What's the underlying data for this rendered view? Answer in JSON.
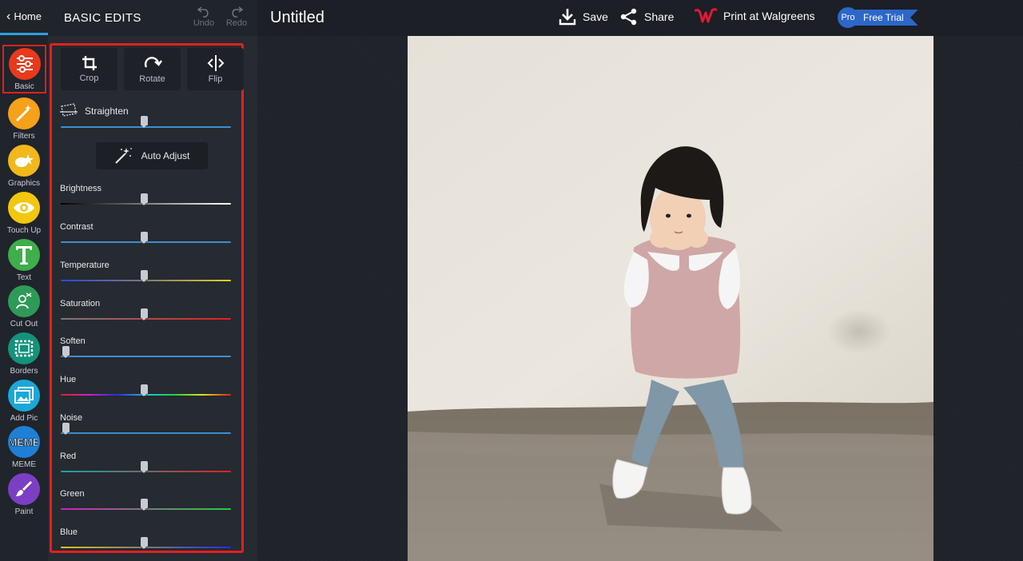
{
  "rail": {
    "home_label": "Home",
    "tools": [
      {
        "label": "Basic",
        "color": "#e8391c",
        "icon": "sliders-icon",
        "active": true
      },
      {
        "label": "Filters",
        "color": "#f5a11a",
        "icon": "magic-wand-icon"
      },
      {
        "label": "Graphics",
        "color": "#f0b81a",
        "icon": "stars-icon"
      },
      {
        "label": "Touch Up",
        "color": "#f2c70e",
        "icon": "eye-icon"
      },
      {
        "label": "Text",
        "color": "#3fae4b",
        "icon": "text-t-icon"
      },
      {
        "label": "Cut Out",
        "color": "#2e9a58",
        "icon": "cutout-person-icon"
      },
      {
        "label": "Borders",
        "color": "#14927a",
        "icon": "border-frame-icon"
      },
      {
        "label": "Add Pic",
        "color": "#1aa8d8",
        "icon": "add-picture-icon"
      },
      {
        "label": "MEME",
        "color": "#1e7fd6",
        "icon": "meme-icon"
      },
      {
        "label": "Paint",
        "color": "#7b3fc4",
        "icon": "paint-brush-icon"
      }
    ]
  },
  "panel": {
    "title": "BASIC EDITS",
    "undo_label": "Undo",
    "redo_label": "Redo",
    "quick_actions": [
      {
        "label": "Crop",
        "icon": "crop-icon"
      },
      {
        "label": "Rotate",
        "icon": "rotate-icon"
      },
      {
        "label": "Flip",
        "icon": "flip-icon"
      }
    ],
    "straighten": {
      "label": "Straighten",
      "value": 0.5
    },
    "auto_adjust_label": "Auto Adjust",
    "sliders": [
      {
        "label": "Brightness",
        "value": 0.5,
        "gradient": "linear-gradient(90deg,#000,#fff)"
      },
      {
        "label": "Contrast",
        "value": 0.5,
        "gradient": "linear-gradient(90deg,#3b8fd0,#3b8fd0)"
      },
      {
        "label": "Temperature",
        "value": 0.5,
        "gradient": "linear-gradient(90deg,#2a48d8,#7b7b7b,#e6d01c)"
      },
      {
        "label": "Saturation",
        "value": 0.5,
        "gradient": "linear-gradient(90deg,#7a7a7a,#e02020)"
      },
      {
        "label": "Soften",
        "value": 0.0,
        "gradient": "linear-gradient(90deg,#3b8fd0,#3b8fd0)"
      },
      {
        "label": "Hue",
        "value": 0.5,
        "gradient": "linear-gradient(90deg,#e02020,#d020d0,#2030e0,#20c0e0,#20d040,#e0e020,#e02020)"
      },
      {
        "label": "Noise",
        "value": 0.0,
        "gradient": "linear-gradient(90deg,#3b8fd0,#3b8fd0)"
      },
      {
        "label": "Red",
        "value": 0.5,
        "gradient": "linear-gradient(90deg,#1fa0a0,#6a6a6a,#e02020)"
      },
      {
        "label": "Green",
        "value": 0.5,
        "gradient": "linear-gradient(90deg,#d020c0,#7a7a7a,#20d040)"
      },
      {
        "label": "Blue",
        "value": 0.5,
        "gradient": "linear-gradient(90deg,#e0c020,#7a7a7a,#2030e0)"
      }
    ]
  },
  "topbar": {
    "doc_title": "Untitled",
    "save_label": "Save",
    "share_label": "Share",
    "print_label": "Print at Walgreens",
    "pro_badge": "Pro",
    "trial_label": "Free Trial"
  },
  "colors": {
    "accent_blue": "#2f9fe0",
    "highlight_red": "#e02020",
    "walgreens_red": "#e31837",
    "pro_blue": "#2c67c9"
  }
}
